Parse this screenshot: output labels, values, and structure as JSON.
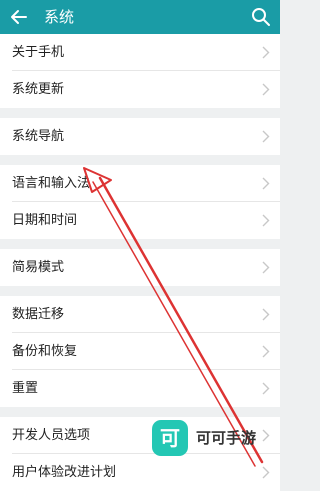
{
  "header": {
    "title": "系统",
    "back_icon": "arrow-left-icon",
    "search_icon": "search-icon",
    "color": "#1a9ca6"
  },
  "settings": {
    "about_phone": "关于手机",
    "system_update": "系统更新",
    "system_navigation": "系统导航",
    "language_input": "语言和输入法",
    "date_time": "日期和时间",
    "simple_mode": "简易模式",
    "data_migration": "数据迁移",
    "backup_restore": "备份和恢复",
    "reset": "重置",
    "developer_options": "开发人员选项",
    "user_experience": "用户体验改进计划"
  },
  "annotation": {
    "color": "#d33",
    "icon": "arrow-annotation"
  },
  "watermark": {
    "logo_char": "可",
    "text": "可可手游"
  }
}
